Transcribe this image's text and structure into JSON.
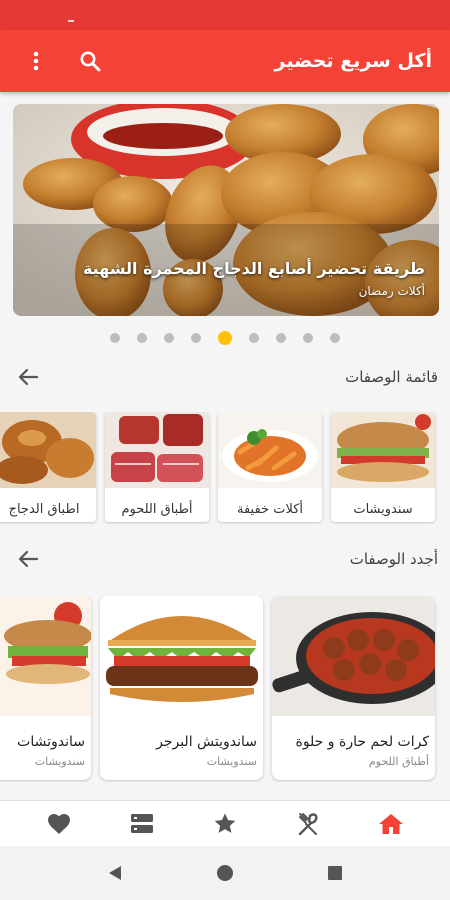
{
  "app": {
    "title": "أكل سريع تحضير",
    "accent": "#f44336"
  },
  "toolbar": {
    "menu_icon": "more-vert-icon",
    "search_icon": "search-icon"
  },
  "banner": {
    "title": "طريقة تحضير أصابع الدجاج المحمرة الشهية",
    "subtitle": "أكلات رمضان",
    "dot_count": 9,
    "active_dot": 4
  },
  "categories": {
    "heading": "قائمة الوصفات",
    "items": [
      {
        "label": "سندويشات"
      },
      {
        "label": "أكلات خفيفة"
      },
      {
        "label": "أطباق اللحوم"
      },
      {
        "label": "اطباق الدجاج"
      }
    ]
  },
  "recipes": {
    "heading": "أجدد الوصفات",
    "items": [
      {
        "title": "كرات لحم حارة و حلوة",
        "category": "أطباق اللحوم"
      },
      {
        "title": "ساندويتش البرجر",
        "category": "سندويشات"
      },
      {
        "title": "ساندوتشات",
        "category": "سندويشات"
      }
    ]
  },
  "bottom_nav": {
    "active": "home",
    "items": [
      "favorites-icon",
      "categories-icon",
      "star-icon",
      "recipes-icon",
      "home-icon"
    ],
    "active_color": "#f44336"
  },
  "system_nav": [
    "back-icon",
    "home-circle-icon",
    "recents-icon"
  ]
}
